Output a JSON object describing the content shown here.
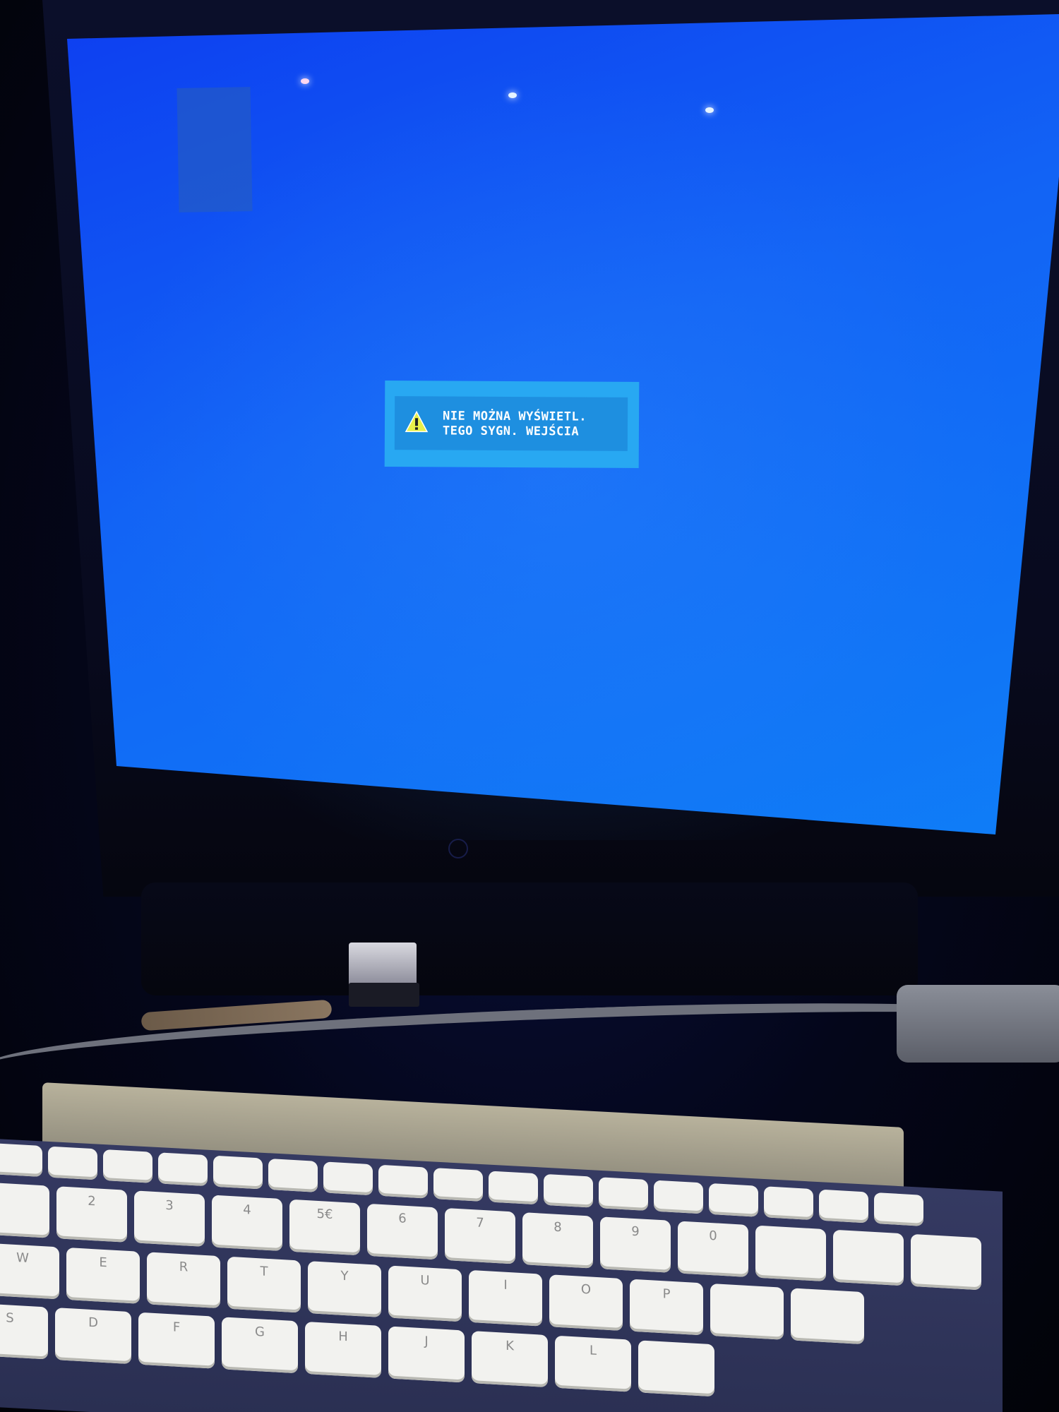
{
  "scene": "monitor-no-signal",
  "monitor": {
    "screen_color": "#1263f5",
    "osd": {
      "icon": "warning-icon",
      "line1": "NIE MOŻNA WYŚWIETL.",
      "line2": "TEGO SYGN. WEJŚCIA",
      "background": "#28a8f2"
    }
  },
  "laptop": {
    "power_led_color": "#35b8ff",
    "keyboard_rows": [
      [
        "",
        "",
        "",
        "",
        "",
        "",
        "",
        "",
        "",
        "",
        "",
        "",
        "",
        "",
        "",
        "",
        ""
      ],
      [
        "",
        "2",
        "3",
        "4",
        "5€",
        "6",
        "7",
        "8",
        "9",
        "0",
        "",
        "",
        ""
      ],
      [
        "W",
        "E",
        "R",
        "T",
        "Y",
        "U",
        "I",
        "O",
        "P",
        "",
        ""
      ],
      [
        "S",
        "D",
        "F",
        "G",
        "H",
        "J",
        "K",
        "L",
        ""
      ]
    ]
  }
}
